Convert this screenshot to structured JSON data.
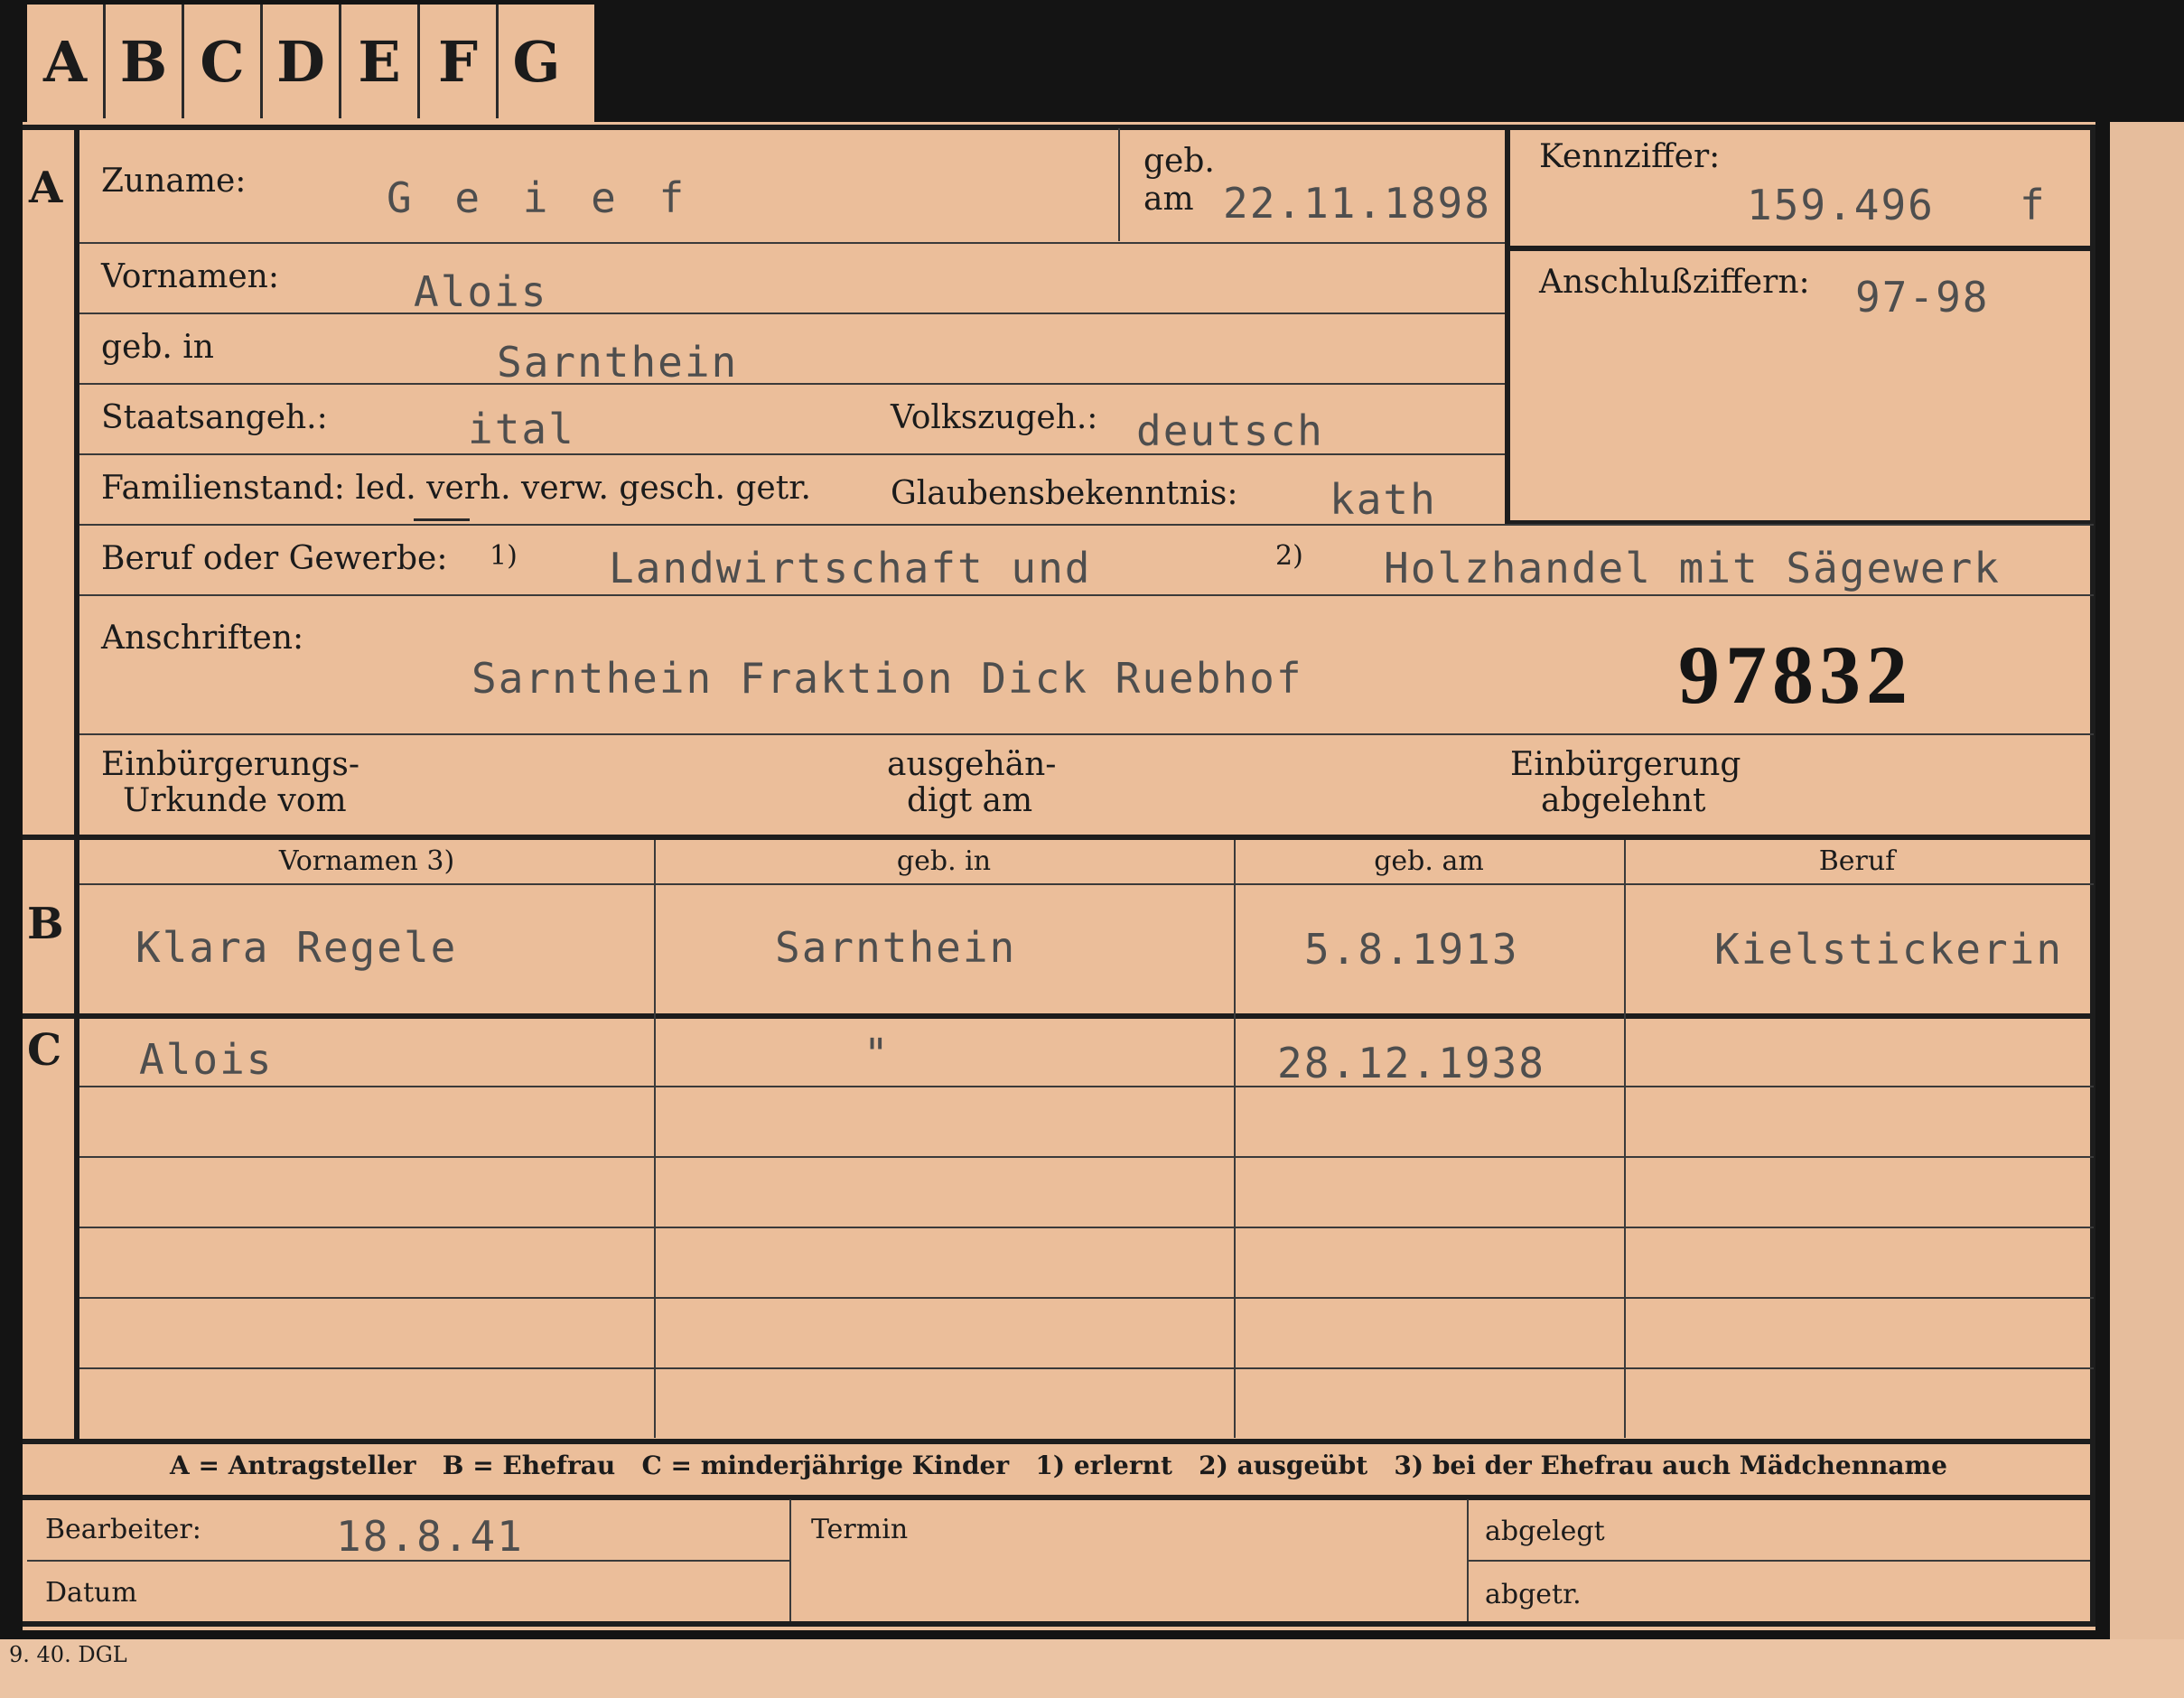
{
  "tabs": [
    "A",
    "B",
    "C",
    "D",
    "E",
    "F",
    "G"
  ],
  "section_markers": {
    "a": "A",
    "b": "B",
    "c": "C"
  },
  "applicant": {
    "surname_label": "Zuname:",
    "surname": "G e i e f",
    "birth_date_label_top": "geb.",
    "birth_date_label_bottom": "am",
    "birth_date": "22.11.1898",
    "id_label": "Kennziffer:",
    "id_number": "159.496",
    "id_suffix": "f",
    "link_label": "Anschlußziffern:",
    "link_numbers": "97-98",
    "first_names_label": "Vornamen:",
    "first_names": "Alois",
    "birthplace_label": "geb. in",
    "birthplace": "Sarnthein",
    "citizenship_label": "Staatsangeh.:",
    "citizenship": "ital",
    "ethnicity_label": "Volkszugeh.:",
    "ethnicity": "deutsch",
    "marital_label": "Familienstand: led. verh. verw. gesch. getr.",
    "religion_label": "Glaubensbekenntnis:",
    "religion": "kath",
    "occupation_label": "Beruf oder Gewerbe:",
    "occ_mark_1": "1)",
    "occupation_1": "Landwirtschaft und",
    "occ_mark_2": "2)",
    "occupation_2": "Holzhandel mit Sägewerk",
    "address_label": "Anschriften:",
    "address": "Sarnthein Fraktion Dick Ruebhof",
    "stamp_number": "97832",
    "naturalization_doc_label_1": "Einbürgerungs-",
    "naturalization_doc_label_2": "Urkunde vom",
    "handed_label_1": "ausgehän-",
    "handed_label_2": "digt am",
    "refused_label_1": "Einbürgerung",
    "refused_label_2": "abgelehnt"
  },
  "family_table": {
    "headers": [
      "Vornamen 3)",
      "geb. in",
      "geb. am",
      "Beruf"
    ],
    "spouse": {
      "first_names": "Klara Regele",
      "birthplace": "Sarnthein",
      "birth_date": "5.8.1913",
      "occupation": "Kielstickerin"
    },
    "children": [
      {
        "first_names": "Alois",
        "birthplace": "\"",
        "birth_date": "28.12.1938",
        "occupation": ""
      }
    ]
  },
  "legend": "A = Antragsteller   B = Ehefrau   C = minderjährige Kinder   1) erlernt   2) ausgeübt   3) bei der Ehefrau auch Mädchenname",
  "footer": {
    "clerk_label": "Bearbeiter:",
    "clerk_value": "18.8.41",
    "date_label": "Datum",
    "deadline_label": "Termin",
    "filed_label": "abgelegt",
    "filed2_label": "abgetr."
  },
  "print_code": "9. 40. DGL"
}
